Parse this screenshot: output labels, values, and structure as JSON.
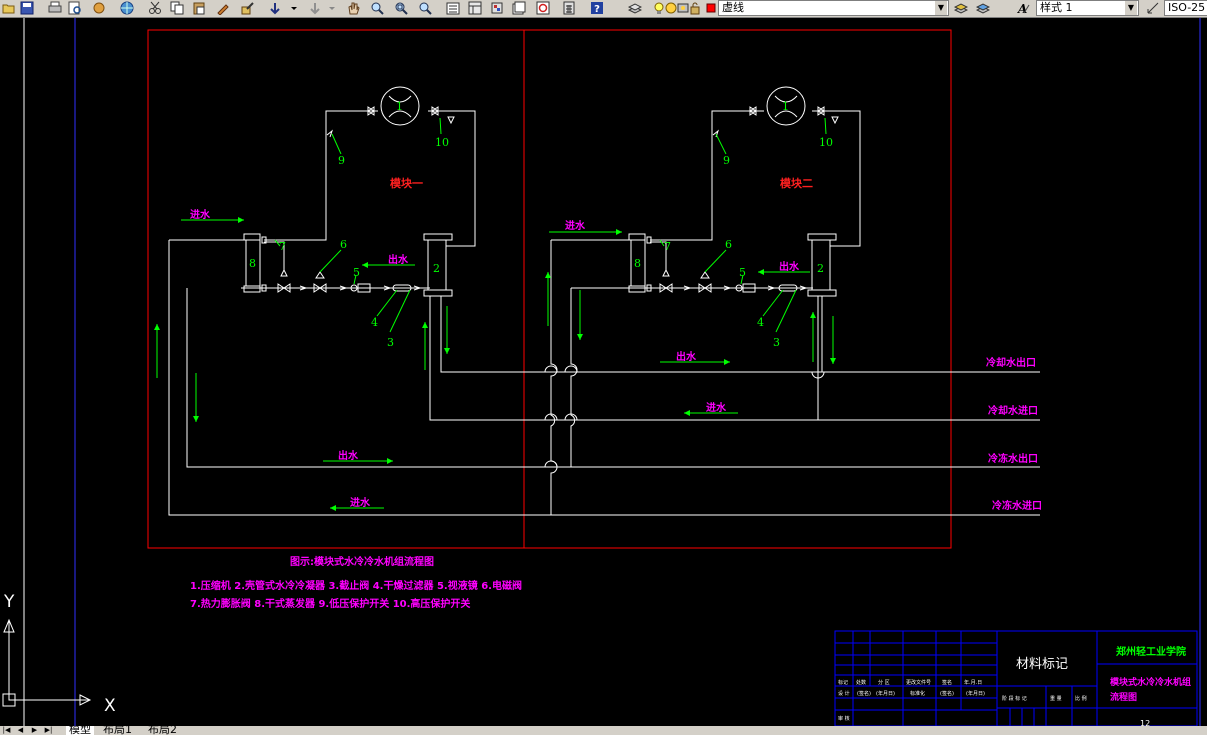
{
  "toolbar": {
    "layer_value": "虚线",
    "style_value": "样式 1",
    "dim_value": "ISO-25"
  },
  "drawing": {
    "module1": "模块一",
    "module2": "模块二",
    "in_water": "进水",
    "out_water": "出水",
    "returns": {
      "cool_out": "冷却水出口",
      "cool_in": "冷却水进口",
      "chill_out": "冷冻水出口",
      "chill_in": "冷冻水进口"
    },
    "labels": {
      "n1": "1",
      "n2": "2",
      "n3": "3",
      "n4": "4",
      "n5": "5",
      "n6": "6",
      "n7": "7",
      "n8": "8",
      "n9": "9",
      "n10": "10"
    },
    "caption": "图示:模块式水冷冷水机组流程图",
    "legend_line1": "1.压缩机 2.壳管式水冷冷凝器 3.截止阀 4.干燥过滤器 5.视液镜 6.电磁阀",
    "legend_line2": "7.热力膨胀阀 8.干式蒸发器 9.低压保护开关 10.高压保护开关"
  },
  "ucs": {
    "y": "Y",
    "x": "X"
  },
  "title_block": {
    "material": "材料标记",
    "school": "郑州轻工业学院",
    "drawing_name_1": "模块式水冷冷水机组",
    "drawing_name_2": "流程图",
    "cells": {
      "mark": "标记",
      "count": "处数",
      "zone": "分 区",
      "doc": "更改文件号",
      "sign": "签名",
      "date": "年.月.日",
      "design": "设 计",
      "sig1": "(签名)",
      "ymd1": "(年月日)",
      "std": "标准化",
      "sig2": "(签名)",
      "ymd2": "(年月日)",
      "audit": "审 核",
      "craft": "工 艺",
      "approve": "批 准",
      "stage": "阶 段 标 记",
      "weight": "重 量",
      "scale": "比 例"
    },
    "sheet_no": "12"
  },
  "tabs": {
    "model": "模型",
    "layout1": "布局1",
    "layout2": "布局2"
  },
  "colors": {
    "frame_red": "#ff0000",
    "pipe_white": "#ffffff",
    "label_green": "#00ff00",
    "text_magenta": "#ff00ff",
    "tb_blue": "#0000ff"
  }
}
